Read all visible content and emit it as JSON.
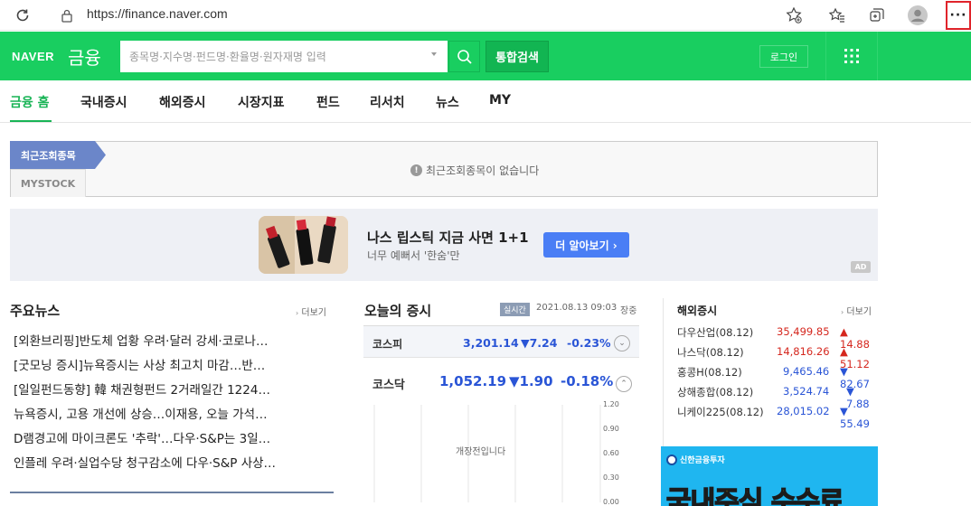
{
  "browser": {
    "url": "https://finance.naver.com",
    "icons": [
      "refresh-icon",
      "lock-icon",
      "add-favorite-icon",
      "favorites-icon",
      "collections-icon",
      "profile-icon",
      "more-icon"
    ]
  },
  "header": {
    "logo": "NAVER",
    "service": "금융",
    "search_placeholder": "종목명·지수명·펀드명·환율명·원자재명 입력",
    "unified_search": "통합검색",
    "login": "로그인",
    "brand_color": "#19ce60"
  },
  "nav": {
    "items": [
      "금융 홈",
      "국내증시",
      "해외증시",
      "시장지표",
      "펀드",
      "리서치",
      "뉴스",
      "MY"
    ],
    "active": "금융 홈"
  },
  "recent": {
    "tab": "최근조회종목",
    "mystock": "MYSTOCK",
    "message": "최근조회종목이 없습니다"
  },
  "ad": {
    "title": "나스 립스틱 지금 사면 1+1",
    "subtitle": "너무 예뻐서 '한숨'만",
    "button": "더 알아보기 ›",
    "tag": "AD"
  },
  "news": {
    "title": "주요뉴스",
    "more": "더보기",
    "items": [
      "[외환브리핑]반도체 업황 우려·달러 강세·코로나…",
      "[굿모닝 증시]뉴욕증시는 사상 최고치 마감…반…",
      "[일일펀드동향] 韓 채권형펀드 2거래일간 1224…",
      "뉴욕증시, 고용 개선에 상승…이재용, 오늘 가석…",
      "D램경고에 마이크론도 '추락'…다우·S&P는 3일…",
      "인플레 우려·실업수당 청구감소에 다우·S&P 사상…"
    ]
  },
  "market": {
    "title": "오늘의 증시",
    "realtime": "실시간",
    "datetime": "2021.08.13 09:03",
    "status": "장중",
    "kospi": {
      "name": "코스피",
      "value": "3,201.14",
      "change": "▼7.24",
      "rate": "-0.23%"
    },
    "kosdaq": {
      "name": "코스닥",
      "value": "1,052.19",
      "change": "▼1.90",
      "rate": "-0.18%"
    },
    "chart_msg": "개장전입니다",
    "chart_yticks": [
      "1.20",
      "0.90",
      "0.60",
      "0.30",
      "0.00"
    ]
  },
  "overseas": {
    "title": "해외증시",
    "more": "더보기",
    "rows": [
      {
        "name": "다우산업(08.12)",
        "value": "35,499.85",
        "change": "▲ 14.88",
        "dir": "up"
      },
      {
        "name": "나스닥(08.12)",
        "value": "14,816.26",
        "change": "▲ 51.12",
        "dir": "up"
      },
      {
        "name": "홍콩H(08.12)",
        "value": "9,465.46",
        "change": "▼ 82.67",
        "dir": "down"
      },
      {
        "name": "상해종합(08.12)",
        "value": "3,524.74",
        "change": "▼ 7.88",
        "dir": "down"
      },
      {
        "name": "니케이225(08.12)",
        "value": "28,015.02",
        "change": "▼ 55.49",
        "dir": "down"
      }
    ]
  },
  "banner": {
    "brand": "신한금융투자",
    "headline": "국내주식 수수료"
  }
}
